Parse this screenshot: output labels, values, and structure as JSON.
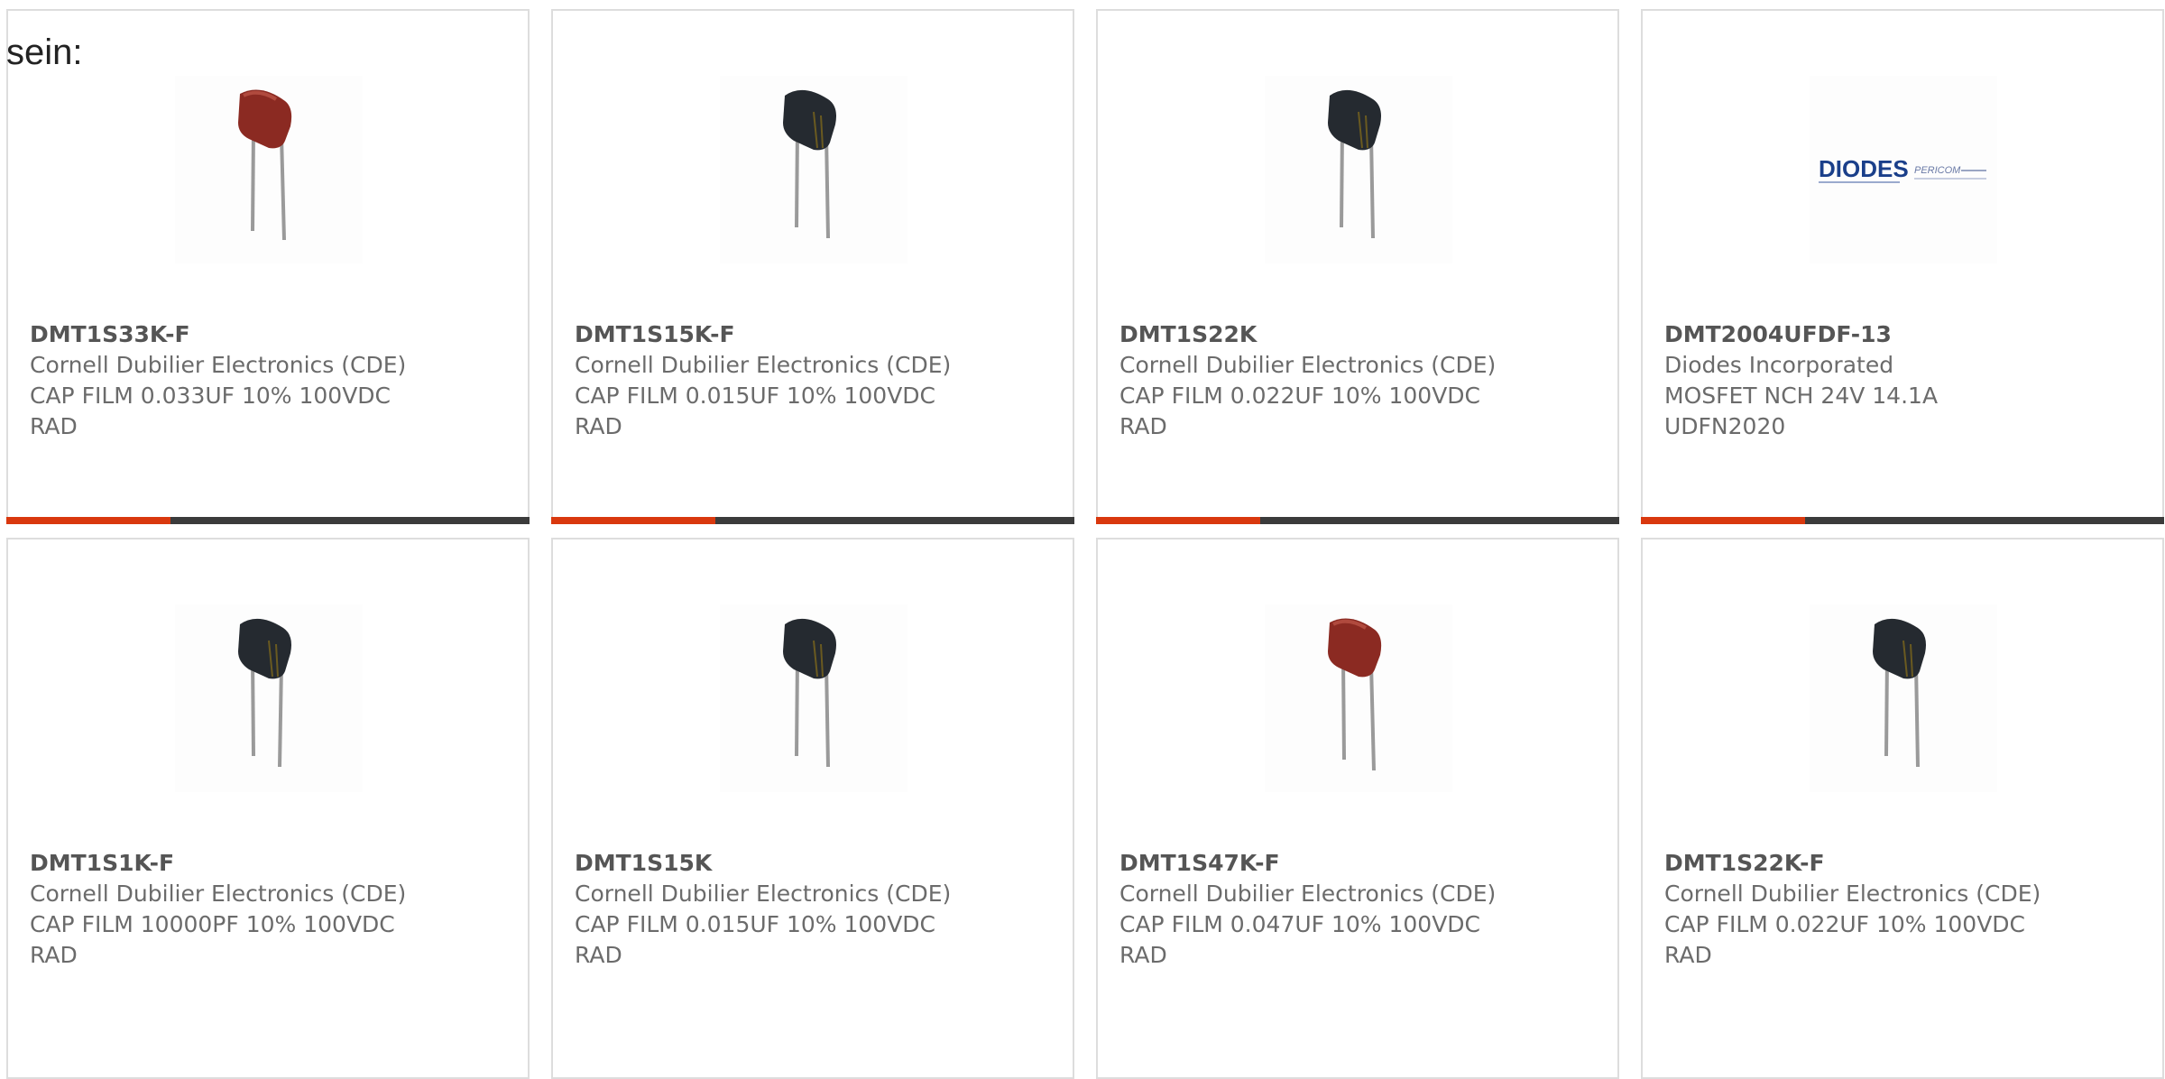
{
  "intro_text": "sein:",
  "colors": {
    "accent": "#d9380e",
    "bar": "#3b3b3b",
    "red_cap": "#8b2a22",
    "black_cap": "#252a30"
  },
  "products": [
    {
      "part": "DMT1S33K-F",
      "maker": "Cornell Dubilier Electronics (CDE)",
      "desc1": "CAP FILM 0.033UF 10% 100VDC",
      "desc2": "RAD",
      "image": "red-film-capacitor-icon"
    },
    {
      "part": "DMT1S15K-F",
      "maker": "Cornell Dubilier Electronics (CDE)",
      "desc1": "CAP FILM 0.015UF 10% 100VDC",
      "desc2": "RAD",
      "image": "black-film-capacitor-icon"
    },
    {
      "part": "DMT1S22K",
      "maker": "Cornell Dubilier Electronics (CDE)",
      "desc1": "CAP FILM 0.022UF 10% 100VDC",
      "desc2": "RAD",
      "image": "black-film-capacitor-icon"
    },
    {
      "part": "DMT2004UFDF-13",
      "maker": "Diodes Incorporated",
      "desc1": "MOSFET NCH 24V 14.1A",
      "desc2": "UDFN2020",
      "image": "diodes-logo",
      "logo_text": "DIODES",
      "logo_sub": "PERICOM"
    },
    {
      "part": "DMT1S1K-F",
      "maker": "Cornell Dubilier Electronics (CDE)",
      "desc1": "CAP FILM 10000PF 10% 100VDC",
      "desc2": "RAD",
      "image": "black-film-capacitor-icon"
    },
    {
      "part": "DMT1S15K",
      "maker": "Cornell Dubilier Electronics (CDE)",
      "desc1": "CAP FILM 0.015UF 10% 100VDC",
      "desc2": "RAD",
      "image": "black-film-capacitor-icon"
    },
    {
      "part": "DMT1S47K-F",
      "maker": "Cornell Dubilier Electronics (CDE)",
      "desc1": "CAP FILM 0.047UF 10% 100VDC",
      "desc2": "RAD",
      "image": "red-film-capacitor-icon"
    },
    {
      "part": "DMT1S22K-F",
      "maker": "Cornell Dubilier Electronics (CDE)",
      "desc1": "CAP FILM 0.022UF 10% 100VDC",
      "desc2": "RAD",
      "image": "black-film-capacitor-icon"
    }
  ]
}
